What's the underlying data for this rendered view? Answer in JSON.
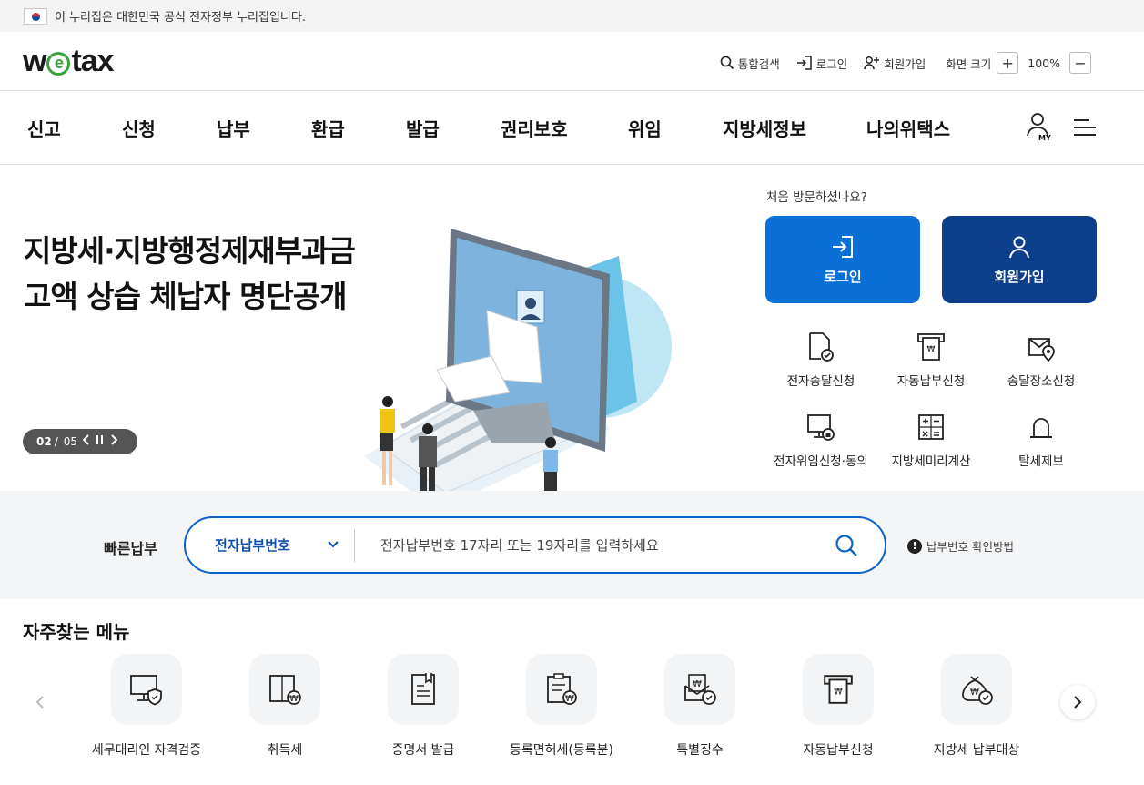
{
  "gov_banner": {
    "text": "이 누리집은 대한민국 공식 전자정부 누리집입니다."
  },
  "header": {
    "logo": "wetax",
    "util": {
      "search": "통합검색",
      "login": "로그인",
      "join": "회원가입",
      "zoom_label": "화면 크기",
      "zoom_in": "+",
      "zoom_value": "100%",
      "zoom_out": "−"
    }
  },
  "nav": {
    "items": [
      "신고",
      "신청",
      "납부",
      "환급",
      "발급",
      "권리보호",
      "위임",
      "지방세정보",
      "나의위택스"
    ],
    "my_label": "MY"
  },
  "hero": {
    "title_line1": "지방세·지방행정제재부과금",
    "title_line2": "고액 상습 체납자 명단공개",
    "slide_current": "02",
    "slide_sep": "/",
    "slide_total": "05",
    "visit_label": "처음 방문하셨나요?",
    "login_button": "로그인",
    "join_button": "회원가입",
    "quick_links": [
      {
        "label": "전자송달신청",
        "icon": "document-check-icon"
      },
      {
        "label": "자동납부신청",
        "icon": "auto-payment-icon"
      },
      {
        "label": "송달장소신청",
        "icon": "location-envelope-icon"
      },
      {
        "label": "전자위임신청·동의",
        "icon": "monitor-lock-icon"
      },
      {
        "label": "지방세미리계산",
        "icon": "calculator-icon"
      },
      {
        "label": "탈세제보",
        "icon": "siren-icon"
      }
    ]
  },
  "quick_pay": {
    "label": "빠른납부",
    "select_value": "전자납부번호",
    "placeholder": "전자납부번호 17자리 또는 19자리를 입력하세요",
    "help": "납부번호 확인방법"
  },
  "frequent": {
    "title": "자주찾는 메뉴",
    "items": [
      {
        "label": "세무대리인 자격검증",
        "icon": "monitor-shield-icon"
      },
      {
        "label": "취득세",
        "icon": "document-won-icon"
      },
      {
        "label": "증명서 발급",
        "icon": "certificate-icon"
      },
      {
        "label": "등록면허세(등록분)",
        "icon": "clipboard-won-icon"
      },
      {
        "label": "특별징수",
        "icon": "envelope-won-icon"
      },
      {
        "label": "자동납부신청",
        "icon": "auto-payment-icon"
      },
      {
        "label": "지방세 납부대상",
        "icon": "money-bag-icon"
      }
    ]
  },
  "colors": {
    "primary_blue": "#0a6fd6",
    "navy": "#0d3f8c",
    "logo_green": "#3aa23a"
  }
}
